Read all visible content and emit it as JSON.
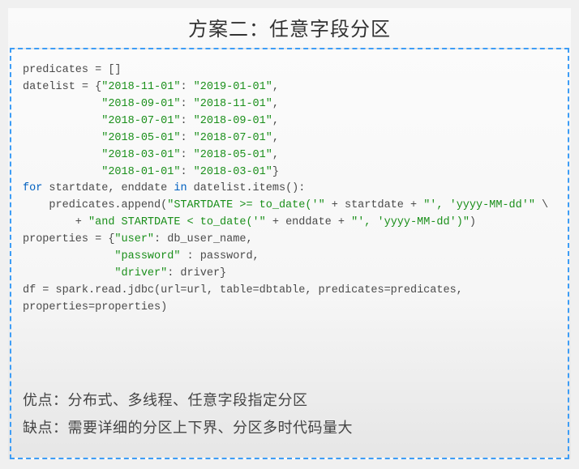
{
  "title": "方案二：任意字段分区",
  "code": {
    "l01": "predicates = []",
    "l02a": "datelist = {",
    "l02b": "\"2018-11-01\"",
    "l02c": ": ",
    "l02d": "\"2019-01-01\"",
    "l02e": ",",
    "l03a": "            ",
    "l03b": "\"2018-09-01\"",
    "l03c": ": ",
    "l03d": "\"2018-11-01\"",
    "l03e": ",",
    "l04a": "            ",
    "l04b": "\"2018-07-01\"",
    "l04c": ": ",
    "l04d": "\"2018-09-01\"",
    "l04e": ",",
    "l05a": "            ",
    "l05b": "\"2018-05-01\"",
    "l05c": ": ",
    "l05d": "\"2018-07-01\"",
    "l05e": ",",
    "l06a": "            ",
    "l06b": "\"2018-03-01\"",
    "l06c": ": ",
    "l06d": "\"2018-05-01\"",
    "l06e": ",",
    "l07a": "            ",
    "l07b": "\"2018-01-01\"",
    "l07c": ": ",
    "l07d": "\"2018-03-01\"",
    "l07e": "}",
    "l08a": "for",
    "l08b": " startdate, enddate ",
    "l08c": "in",
    "l08d": " datelist.items():",
    "l09a": "    predicates.append(",
    "l09b": "\"STARTDATE >= to_date('\"",
    "l09c": " + startdate + ",
    "l09d": "\"', 'yyyy-MM-dd'\"",
    "l09e": " \\",
    "l10a": "        + ",
    "l10b": "\"and STARTDATE < to_date('\"",
    "l10c": " + enddate + ",
    "l10d": "\"', 'yyyy-MM-dd')\"",
    "l10e": ")",
    "l11a": "properties = {",
    "l11b": "\"user\"",
    "l11c": ": db_user_name,",
    "l12a": "              ",
    "l12b": "\"password\"",
    "l12c": " : password,",
    "l13a": "              ",
    "l13b": "\"driver\"",
    "l13c": ": driver}",
    "l14": "df = spark.read.jdbc(url=url, table=dbtable, predicates=predicates,",
    "l15": "properties=properties)"
  },
  "notes": {
    "pros": "优点：分布式、多线程、任意字段指定分区",
    "cons": "缺点：需要详细的分区上下界、分区多时代码量大"
  }
}
